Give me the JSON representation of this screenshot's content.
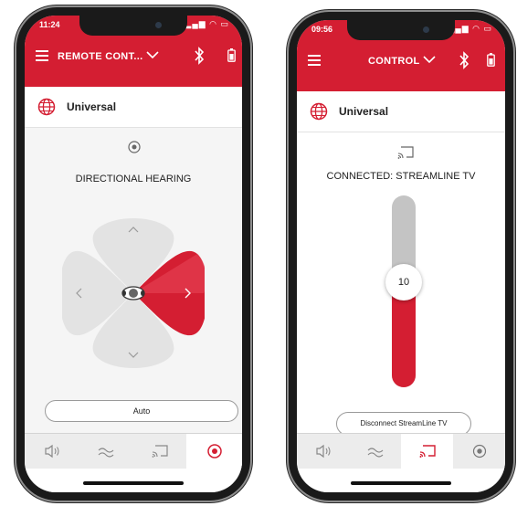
{
  "colors": {
    "accent": "#d41e32",
    "light_petal": "#e3e3e3",
    "track_gray": "#c4c4c4"
  },
  "phone_left": {
    "status_time": "11:24",
    "header_title": "REMOTE CONT...",
    "program": "Universal",
    "section_title": "DIRECTIONAL HEARING",
    "auto_button": "Auto",
    "active_direction": "right",
    "active_tab": "directional"
  },
  "phone_right": {
    "status_time": "09:56",
    "header_title": "CONTROL",
    "program": "Universal",
    "connection_status": "CONNECTED: STREAMLINE TV",
    "volume_value": "10",
    "volume_fraction": 0.55,
    "disconnect_button": "Disconnect StreamLine TV",
    "active_tab": "streaming"
  },
  "tabs": [
    {
      "name": "volume",
      "icon": "speaker-icon"
    },
    {
      "name": "sound",
      "icon": "wave-icon"
    },
    {
      "name": "streaming",
      "icon": "cast-icon"
    },
    {
      "name": "directional",
      "icon": "target-icon"
    }
  ]
}
